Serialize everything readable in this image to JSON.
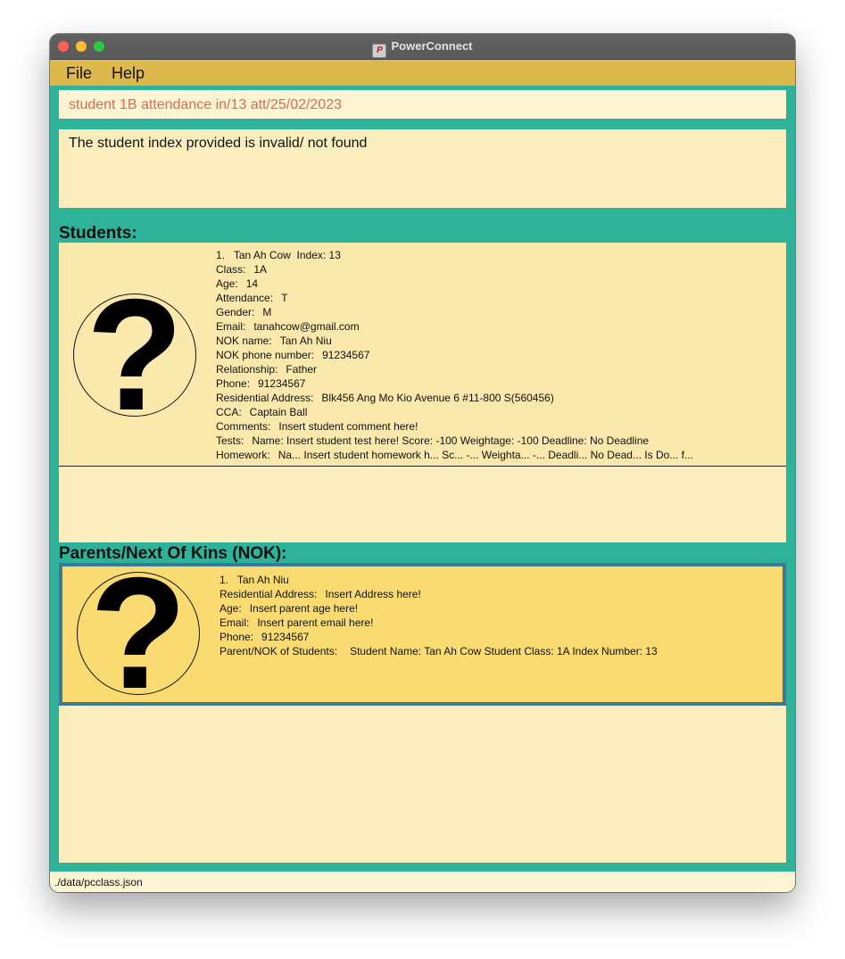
{
  "window": {
    "title": "PowerConnect"
  },
  "menu": {
    "items": [
      "File",
      "Help"
    ]
  },
  "command": {
    "value": "student 1B attendance in/13 att/25/02/2023"
  },
  "result": {
    "text": "The student index provided is invalid/ not found"
  },
  "students": {
    "heading": "Students:",
    "cards": [
      {
        "index_label": "1.",
        "name": "Tan Ah Cow",
        "index_text": "Index: 13",
        "fields": [
          {
            "label": "Class:",
            "value": "1A"
          },
          {
            "label": "Age:",
            "value": "14"
          },
          {
            "label": "Attendance:",
            "value": "T"
          },
          {
            "label": "Gender:",
            "value": "M"
          },
          {
            "label": "Email:",
            "value": "tanahcow@gmail.com"
          },
          {
            "label": "NOK name:",
            "value": "Tan Ah Niu"
          },
          {
            "label": "NOK phone number:",
            "value": "91234567"
          },
          {
            "label": "Relationship:",
            "value": "Father"
          },
          {
            "label": "Phone:",
            "value": "91234567"
          },
          {
            "label": "Residential Address:",
            "value": "Blk456 Ang Mo Kio Avenue 6 #11-800 S(560456)"
          },
          {
            "label": "CCA:",
            "value": "Captain Ball"
          },
          {
            "label": "Comments:",
            "value": "Insert student comment here!"
          },
          {
            "label": "Tests:",
            "value": "Name: Insert student test here! Score: -100 Weightage: -100 Deadline: No Deadline"
          },
          {
            "label": "Homework:",
            "value": "Na...  Insert student homework h...  Sc...  -...  Weighta... -...  Deadli... No Dead...  Is Do...  f..."
          }
        ]
      }
    ]
  },
  "parents": {
    "heading": "Parents/Next Of Kins (NOK):",
    "cards": [
      {
        "index_label": "1.",
        "name": "Tan Ah Niu",
        "fields": [
          {
            "label": "Residential Address:",
            "value": "Insert Address here!"
          },
          {
            "label": "Age:",
            "value": "Insert parent age here!"
          },
          {
            "label": "Email:",
            "value": "Insert parent email here!"
          },
          {
            "label": "Phone:",
            "value": "91234567"
          },
          {
            "label": "Parent/NOK of Students:",
            "value": "Student Name: Tan Ah Cow Student Class: 1A Index Number: 13"
          }
        ]
      }
    ]
  },
  "avatar": {
    "icon": "question-mark-icon",
    "glyph": "?"
  },
  "status": {
    "path": "./data/pcclass.json"
  },
  "colors": {
    "background": "#2eb39a",
    "menubar": "#dcb94a",
    "command_text": "#d0704e",
    "card": "#fbe8ac",
    "selected_card": "#f9db72",
    "selected_border": "#3b7a94"
  }
}
